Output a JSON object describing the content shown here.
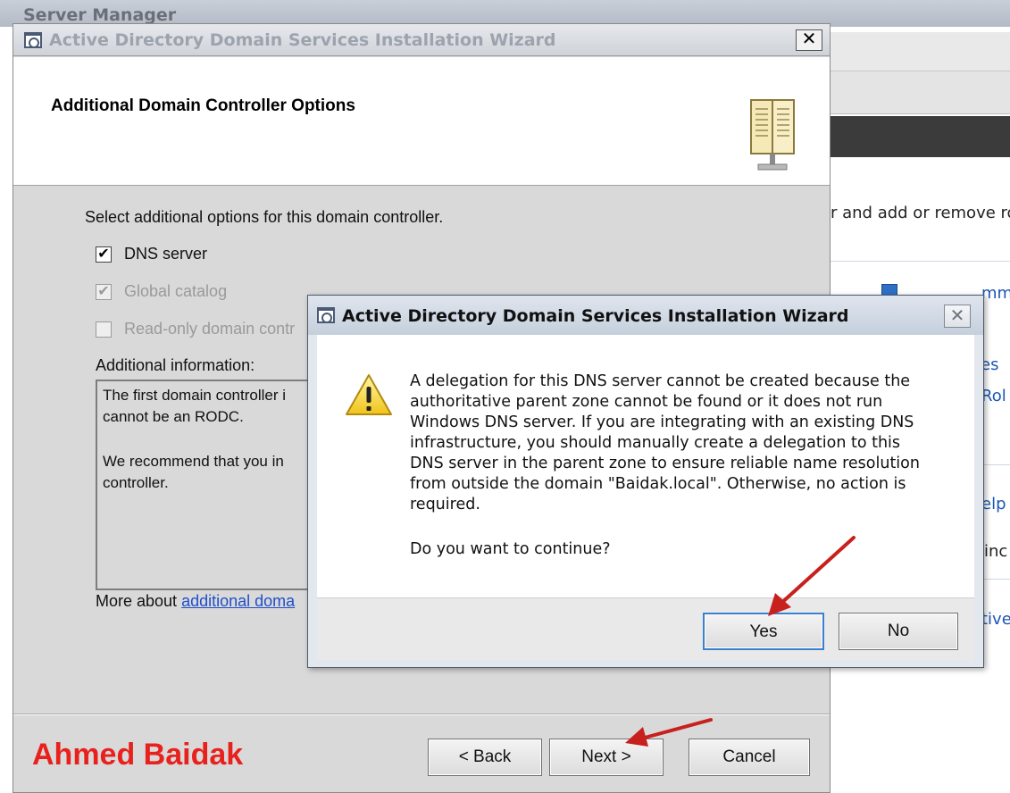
{
  "background_window": {
    "title": "Server Manager",
    "fragments": {
      "add_remove": "r and add or remove ro",
      "summary_link": "mma",
      "link_s": "es",
      "link_role": "Rol",
      "help": "elp",
      "inc": "inc",
      "active": "tive"
    }
  },
  "wizard": {
    "title": "Active Directory Domain Services Installation Wizard",
    "close_label": "✕",
    "heading": "Additional Domain Controller Options",
    "instruction": "Select additional options for this domain controller.",
    "options": [
      {
        "label": "DNS server",
        "checked": true,
        "enabled": true
      },
      {
        "label": "Global catalog",
        "checked": true,
        "enabled": false
      },
      {
        "label": "Read-only domain contr",
        "checked": false,
        "enabled": false
      }
    ],
    "additional_info_label": "Additional information:",
    "info_lines": [
      "The first domain controller i",
      "cannot be an RODC.",
      "",
      "We recommend that you in",
      "controller."
    ],
    "more_about_prefix": "More about ",
    "more_about_link": "additional doma",
    "buttons": {
      "back": "< Back",
      "next": "Next >",
      "cancel": "Cancel"
    }
  },
  "watermark": "Ahmed Baidak",
  "dialog": {
    "title": "Active Directory Domain Services Installation Wizard",
    "close_label": "✕",
    "message_lines": [
      "A delegation for this DNS server cannot be created because the",
      "authoritative parent zone cannot be found or it does not run",
      "Windows DNS server. If you are integrating with an existing DNS",
      "infrastructure, you should manually create a delegation to this",
      "DNS server in the parent zone to ensure reliable name resolution",
      "from outside the domain \"Baidak.local\". Otherwise, no action is",
      "required."
    ],
    "question": "Do you want to continue?",
    "buttons": {
      "yes": "Yes",
      "no": "No"
    }
  },
  "colors": {
    "watermark": "#e8211d",
    "arrow": "#c8201c",
    "link": "#1f4fc9"
  },
  "icons": [
    "app-icon",
    "book-icon",
    "warning-icon",
    "close-icon",
    "arrow-icon"
  ]
}
